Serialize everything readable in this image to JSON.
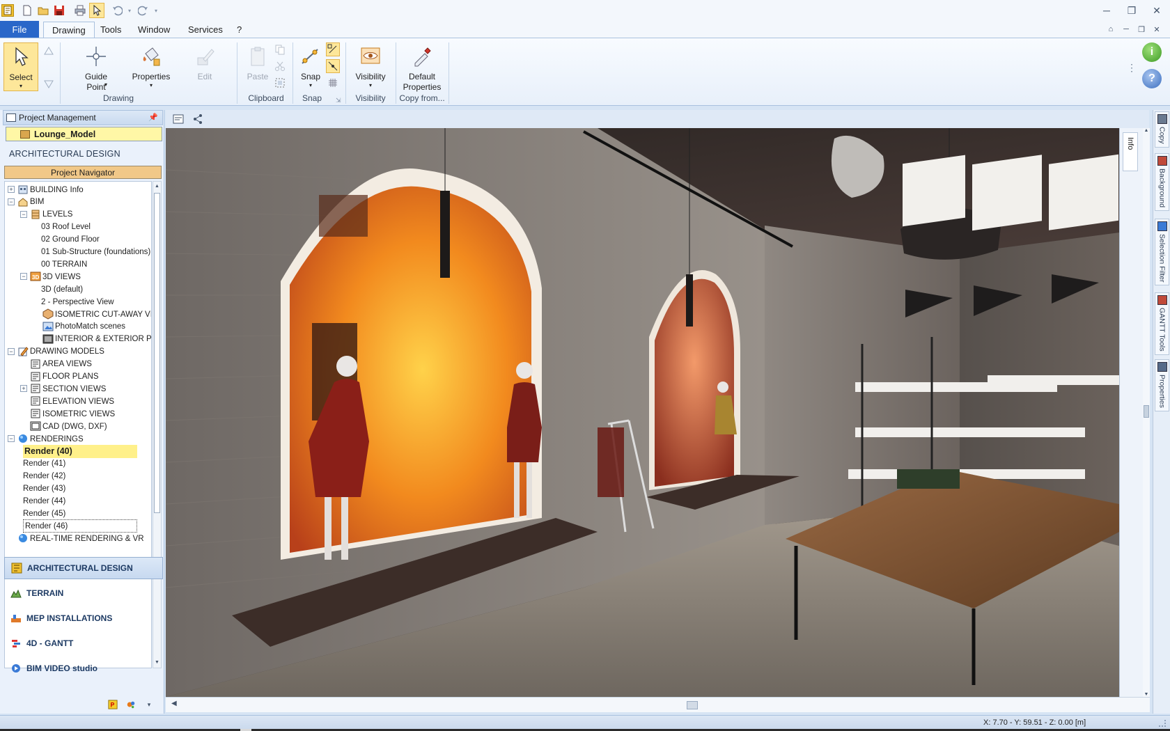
{
  "titlebar": {
    "quick_access": [
      "app-icon",
      "new-file-icon",
      "open-folder-icon",
      "save-icon",
      "print-icon",
      "select-pointer-icon",
      "undo-icon",
      "redo-icon"
    ],
    "controls": [
      "minimize",
      "restore",
      "close"
    ]
  },
  "menu": {
    "file": "File",
    "tabs": [
      "Drawing",
      "Tools",
      "Window",
      "Services",
      "?"
    ],
    "active_tab": "Drawing"
  },
  "ribbon": {
    "groups": {
      "drawing": "Drawing",
      "clipboard": "Clipboard",
      "snap": "Snap",
      "visibility": "Visibility",
      "copy_from": "Copy from..."
    },
    "buttons": {
      "select": "Select",
      "guide_point_1": "Guide",
      "guide_point_2": "Point",
      "properties": "Properties",
      "edit": "Edit",
      "paste": "Paste",
      "snap": "Snap",
      "visibility": "Visibility",
      "default_properties_1": "Default",
      "default_properties_2": "Properties"
    },
    "accent": "#fde79a"
  },
  "panel": {
    "title": "Project Management",
    "model": "Lounge_Model",
    "section": "ARCHITECTURAL DESIGN",
    "navigator": "Project Navigator",
    "tree": [
      {
        "label": "BUILDING Info",
        "toggle": "+"
      },
      {
        "label": "BIM",
        "toggle": "−"
      },
      {
        "label": "LEVELS",
        "toggle": "−"
      },
      {
        "label": "03 Roof Level"
      },
      {
        "label": "02 Ground Floor"
      },
      {
        "label": "01 Sub-Structure (foundations)"
      },
      {
        "label": "00 TERRAIN"
      },
      {
        "label": "3D VIEWS",
        "toggle": "−"
      },
      {
        "label": "3D (default)"
      },
      {
        "label": "2 - Perspective View"
      },
      {
        "label": "ISOMETRIC CUT-AWAY VIE"
      },
      {
        "label": "PhotoMatch scenes"
      },
      {
        "label": "INTERIOR & EXTERIOR PHO"
      },
      {
        "label": "DRAWING MODELS",
        "toggle": "−"
      },
      {
        "label": "AREA VIEWS"
      },
      {
        "label": "FLOOR PLANS"
      },
      {
        "label": "SECTION VIEWS",
        "toggle": "+"
      },
      {
        "label": "ELEVATION VIEWS"
      },
      {
        "label": "ISOMETRIC VIEWS"
      },
      {
        "label": "CAD (DWG, DXF)"
      },
      {
        "label": "RENDERINGS",
        "toggle": "−"
      },
      {
        "label": "Render (40)",
        "selected": true
      },
      {
        "label": "Render (41)"
      },
      {
        "label": "Render (42)"
      },
      {
        "label": "Render (43)"
      },
      {
        "label": "Render (44)"
      },
      {
        "label": "Render (45)"
      },
      {
        "label": "Render (46)"
      },
      {
        "label": "REAL-TIME RENDERING & VR"
      }
    ],
    "modules": [
      {
        "label": "ARCHITECTURAL DESIGN",
        "icon": "architectural-design-icon",
        "active": true
      },
      {
        "label": "TERRAIN",
        "icon": "terrain-icon"
      },
      {
        "label": "MEP INSTALLATIONS",
        "icon": "mep-icon"
      },
      {
        "label": "4D - GANTT",
        "icon": "gantt-icon"
      },
      {
        "label": "BIM VIDEO studio",
        "icon": "video-studio-icon"
      }
    ]
  },
  "viewport": {
    "info_tab": "Info",
    "scene": "rendered-interior-showroom"
  },
  "right_strip": [
    "Copy",
    "Background",
    "Selection Filter",
    "GANTT Tools",
    "Properties"
  ],
  "status": {
    "coords": "X: 7.70 - Y: 59.51 - Z: 0.00 [m]"
  }
}
